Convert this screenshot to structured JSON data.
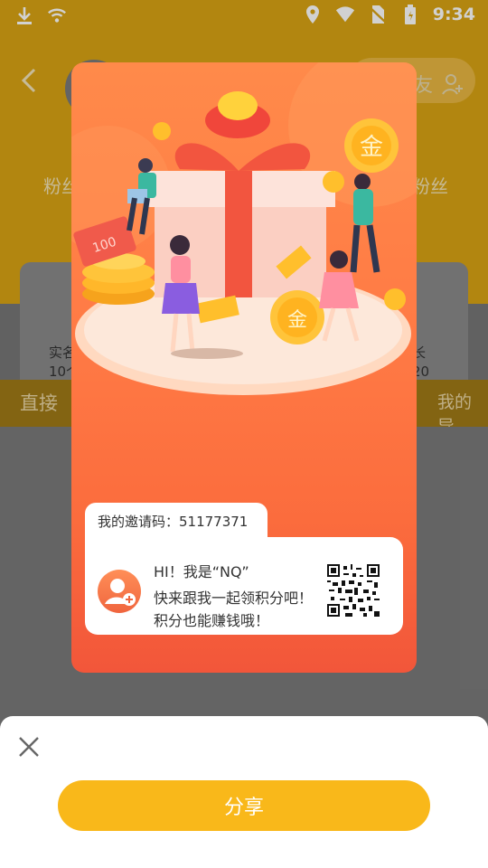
{
  "status_bar": {
    "time": "9:34"
  },
  "background": {
    "invite_label": "友",
    "fans_left": "粉丝",
    "fans_right": "粉丝",
    "card_left_line1": "实名",
    "card_left_line2": "10个",
    "card_right_line1": "长",
    "card_right_line2": "20",
    "direct_tab": "直接",
    "my_tab": "我的导"
  },
  "poster": {
    "invite_code_label": "我的邀请码：51177371",
    "greeting": "HI！我是“NQ”",
    "line2": "快来跟我一起领积分吧！",
    "line3": "积分也能赚钱哦！",
    "coin_char": "金",
    "banknote_text": "100"
  },
  "sheet": {
    "share_label": "分享"
  },
  "colors": {
    "accent": "#f9b81a",
    "poster_top": "#ff8a4a",
    "poster_bottom": "#f2563a"
  }
}
